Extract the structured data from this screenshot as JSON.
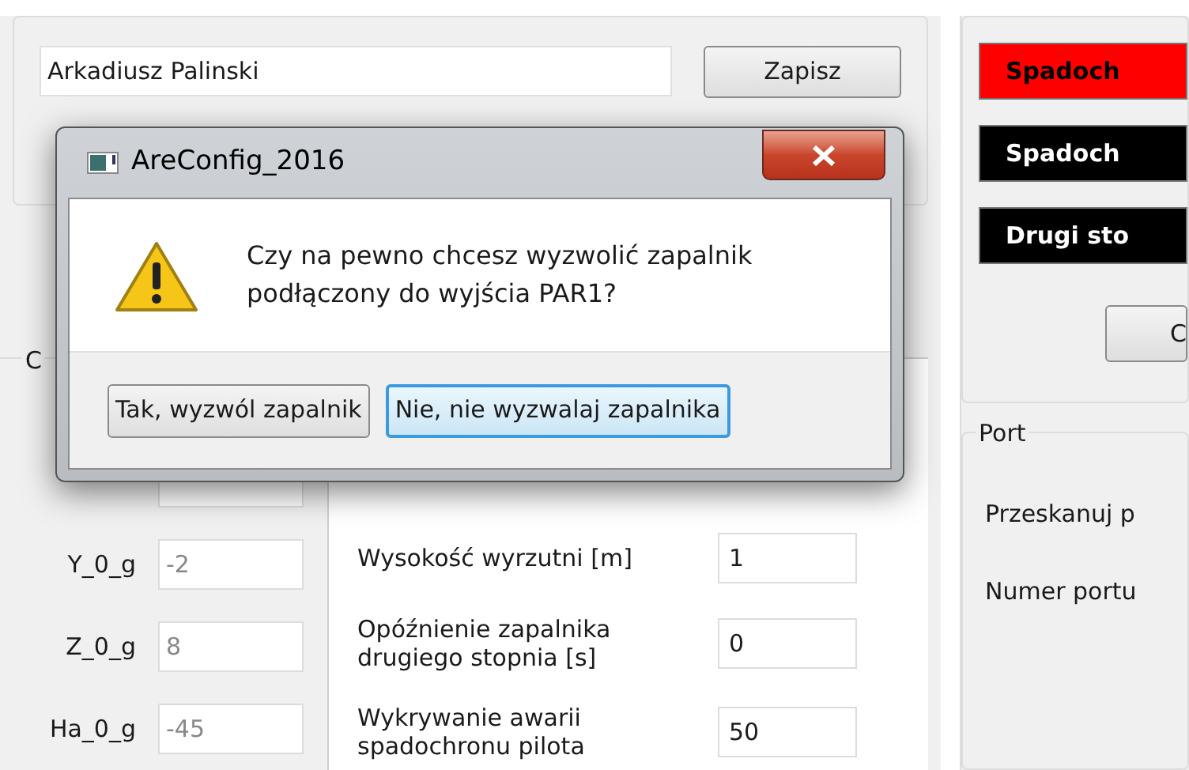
{
  "user": {
    "name": "Arkadiusz Palinski",
    "save_button": "Zapisz"
  },
  "left_group": {
    "title": "C",
    "fields": [
      {
        "label": "Y_0_g",
        "value": "-2"
      },
      {
        "label": "Z_0_g",
        "value": "8"
      },
      {
        "label": "Ha_0_g",
        "value": "-45"
      }
    ]
  },
  "settings": {
    "fields": [
      {
        "label": "Wysokość wyrzutni [m]",
        "value": "1"
      },
      {
        "label": "Opóźnienie zapalnika drugiego stopnia [s]",
        "value": "0"
      },
      {
        "label": "Wykrywanie awarii spadochronu pilota",
        "value": "50"
      }
    ]
  },
  "indicators": [
    {
      "label": "Spadoch",
      "color": "#ff0000"
    },
    {
      "label": "Spadoch",
      "color": "#000000"
    },
    {
      "label": "Drugi sto",
      "color": "#000000"
    }
  ],
  "right_button": "C",
  "port": {
    "title": "Port",
    "labels": [
      "Przeskanuj p",
      "Numer portu"
    ]
  },
  "dialog": {
    "title": "AreConfig_2016",
    "message": "Czy na pewno chcesz wyzwolić zapalnik podłączony do wyjścia PAR1?",
    "buttons": [
      {
        "label": "Tak, wyzwól zapalnik",
        "selected": false
      },
      {
        "label": "Nie, nie wyzwalaj zapalnika",
        "selected": true
      }
    ]
  }
}
